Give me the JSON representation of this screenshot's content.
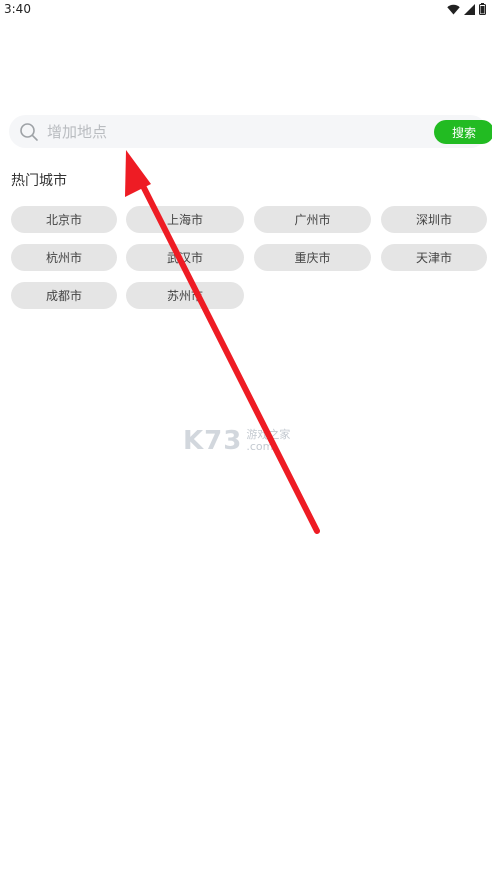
{
  "status_bar": {
    "time": "3:40",
    "icons": [
      "wifi-icon",
      "signal-icon",
      "battery-icon"
    ]
  },
  "search": {
    "placeholder": "增加地点",
    "value": "",
    "button_label": "搜索"
  },
  "hot_cities": {
    "title": "热门城市",
    "items": [
      {
        "label": "北京市"
      },
      {
        "label": "上海市"
      },
      {
        "label": "广州市"
      },
      {
        "label": "深圳市"
      },
      {
        "label": "杭州市"
      },
      {
        "label": "武汉市"
      },
      {
        "label": "重庆市"
      },
      {
        "label": "天津市"
      },
      {
        "label": "成都市"
      },
      {
        "label": "苏州市"
      }
    ]
  },
  "watermark": {
    "logo": "K73",
    "text_cn": "游戏之家",
    "domain": ".com"
  },
  "colors": {
    "accent": "#22bb22",
    "chip_bg": "#e5e5e5",
    "search_bg": "#f5f6f8",
    "arrow": "#ee1c24"
  }
}
